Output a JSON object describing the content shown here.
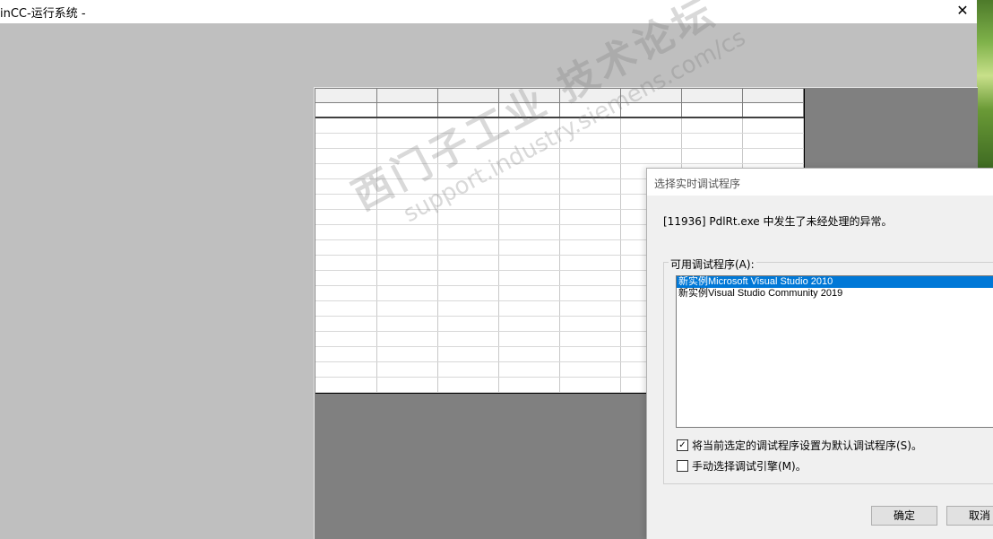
{
  "window": {
    "title": "inCC-运行系统 -",
    "close_glyph": "✕"
  },
  "grid": {
    "columns": 8,
    "body_rows": 18
  },
  "watermark": {
    "line1": "西门子工业 技术论坛",
    "line2": "support.industry.siemens.com/cs"
  },
  "dialog": {
    "title": "选择实时调试程序",
    "message": "[11936] PdlRt.exe 中发生了未经处理的异常。",
    "group_label": "可用调试程序(A):",
    "debuggers": [
      {
        "label": "新实例Microsoft Visual Studio 2010",
        "selected": true
      },
      {
        "label": "新实例Visual Studio Community 2019",
        "selected": false
      }
    ],
    "set_default": {
      "label": "将当前选定的调试程序设置为默认调试程序(S)。",
      "checked": true
    },
    "manual_engine": {
      "label": "手动选择调试引擎(M)。",
      "checked": false
    },
    "ok_label": "确定",
    "cancel_label": "取消"
  },
  "colors": {
    "accent": "#0078d7",
    "background": "#bfbfbf",
    "panel": "#808080"
  }
}
